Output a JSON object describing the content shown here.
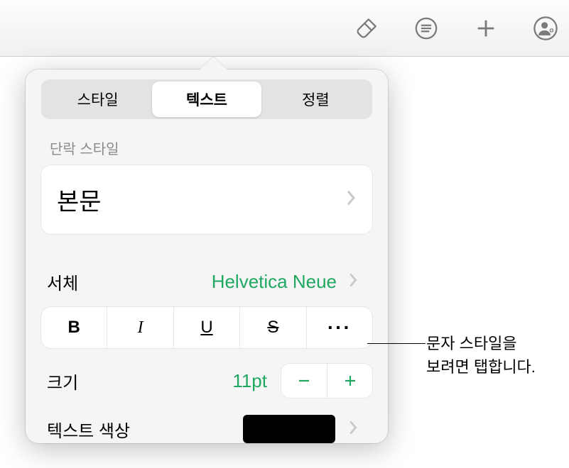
{
  "tabs": {
    "style": "스타일",
    "text": "텍스트",
    "arrange": "정렬"
  },
  "paragraphStyleLabel": "단락 스타일",
  "paragraphStyleValue": "본문",
  "fontLabel": "서체",
  "fontValue": "Helvetica Neue",
  "styleButtons": {
    "bold": "B",
    "italic": "I",
    "underline": "U",
    "strike": "S"
  },
  "sizeLabel": "크기",
  "sizeValue": "11pt",
  "textColorLabel": "텍스트 색상",
  "textColorValue": "#000000",
  "callout": {
    "line1": "문자 스타일을",
    "line2": "보려면 탭합니다."
  }
}
